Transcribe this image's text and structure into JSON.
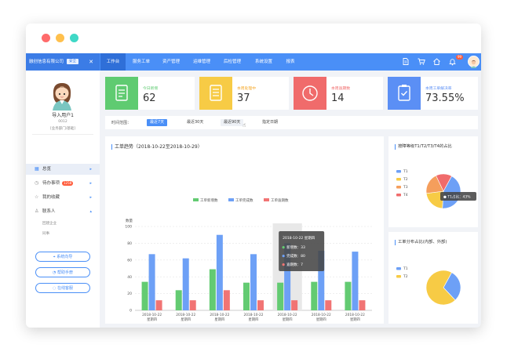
{
  "window_controls": {
    "colors": [
      "#ff6b6b",
      "#ffc04d",
      "#3fd8c6"
    ]
  },
  "navbar": {
    "brand": "融创信息有限公司",
    "brand_tag": "安全",
    "menu_toggle": "✕",
    "items": [
      {
        "label": "工作台",
        "active": true
      },
      {
        "label": "服务工单"
      },
      {
        "label": "资产管理"
      },
      {
        "label": "运维管理"
      },
      {
        "label": "后检管理"
      },
      {
        "label": "系统设置"
      },
      {
        "label": "报表"
      }
    ],
    "notif_count": "99",
    "icons": [
      "document-icon",
      "cart-icon",
      "home-icon",
      "bell-icon"
    ]
  },
  "sidebar": {
    "user_name": "导入用户1",
    "user_id": "0012",
    "user_dept": "[业务部门/基础]",
    "items": [
      {
        "label": "总览",
        "icon": "grid-icon",
        "active": true
      },
      {
        "label": "待办事项",
        "icon": "clock-icon",
        "count": "1258"
      },
      {
        "label": "我的收藏",
        "icon": "star-icon"
      },
      {
        "label": "联系人",
        "icon": "person-icon",
        "expanded": true
      }
    ],
    "sub_items": [
      "回建企业",
      "同事"
    ],
    "buttons": [
      {
        "label": "系统向导",
        "icon": "guide-icon"
      },
      {
        "label": "帮助手册",
        "icon": "help-icon"
      },
      {
        "label": "在线客服",
        "icon": "chat-icon"
      }
    ]
  },
  "stats": [
    {
      "label": "今日新增",
      "value": "62",
      "color": "#5fcb71",
      "label_color": "#5fcb71",
      "icon": "edit-icon"
    },
    {
      "label": "本周处理中",
      "value": "37",
      "color": "#f7cb45",
      "label_color": "#f5a623",
      "icon": "document-icon"
    },
    {
      "label": "本周逾期数",
      "value": "14",
      "color": "#f06b6b",
      "label_color": "#f06b6b",
      "icon": "clock-icon"
    },
    {
      "label": "本周工单解决率",
      "value": "73.55%",
      "color": "#5b8ff5",
      "label_color": "#5b8ff5",
      "icon": "clipboard-check-icon"
    }
  ],
  "filter": {
    "label": "时间范围：",
    "options": [
      {
        "label": "最近7天",
        "active": true
      },
      {
        "label": "最近30天"
      },
      {
        "label": "最近90天",
        "hover": true
      },
      {
        "label": "指定日期"
      }
    ]
  },
  "trend_card": {
    "title": "工单趋势（2018-10-22至2018-10-29）"
  },
  "pie_card_1": {
    "title": "按障等级T1/T2/T3/T4的占比",
    "tooltip": "● T1占比：43%"
  },
  "pie_card_2": {
    "title": "工单分布占比(内部、外部)"
  },
  "chart_data": [
    {
      "type": "bar",
      "title": "工单趋势（2018-10-22至2018-10-29）",
      "ylabel": "数量",
      "ylim": [
        0,
        100
      ],
      "yticks": [
        0,
        20,
        40,
        60,
        80,
        100
      ],
      "categories": [
        "2018-10-22 星期四",
        "2018-10-22 星期四",
        "2018-10-22 星期四",
        "2018-10-22 星期四",
        "2018-10-22 星期四",
        "2018-10-22 星期四",
        "2018-10-22 星期四"
      ],
      "series": [
        {
          "name": "工单新增数",
          "color": "#63cb72",
          "values": [
            34,
            24,
            49,
            33,
            33,
            34,
            34
          ]
        },
        {
          "name": "工单完成数",
          "color": "#6da0f6",
          "values": [
            67,
            62,
            90,
            67,
            80,
            71,
            70
          ]
        },
        {
          "name": "工单逾期数",
          "color": "#f17474",
          "values": [
            12,
            12,
            24,
            12,
            12,
            12,
            12
          ]
        }
      ],
      "legend_position": "top",
      "grid": true,
      "tooltip": {
        "title": "2018-10-22 星期四",
        "rows": [
          "新增数：33",
          "完成数：80",
          "逾期数：7"
        ]
      }
    },
    {
      "type": "pie",
      "title": "按障等级T1/T2/T3/T4的占比",
      "labels": [
        "T1",
        "T2",
        "T3",
        "T4"
      ],
      "values": [
        43,
        22,
        20,
        15
      ],
      "colors": [
        "#6da0f6",
        "#f7cb45",
        "#f59e5c",
        "#f06b6b"
      ],
      "legend_position": "left"
    },
    {
      "type": "pie",
      "title": "工单分布占比(内部、外部)",
      "labels": [
        "T1",
        "T2"
      ],
      "values": [
        30,
        70
      ],
      "colors": [
        "#6da0f6",
        "#f7cb45"
      ],
      "legend_position": "left"
    }
  ]
}
